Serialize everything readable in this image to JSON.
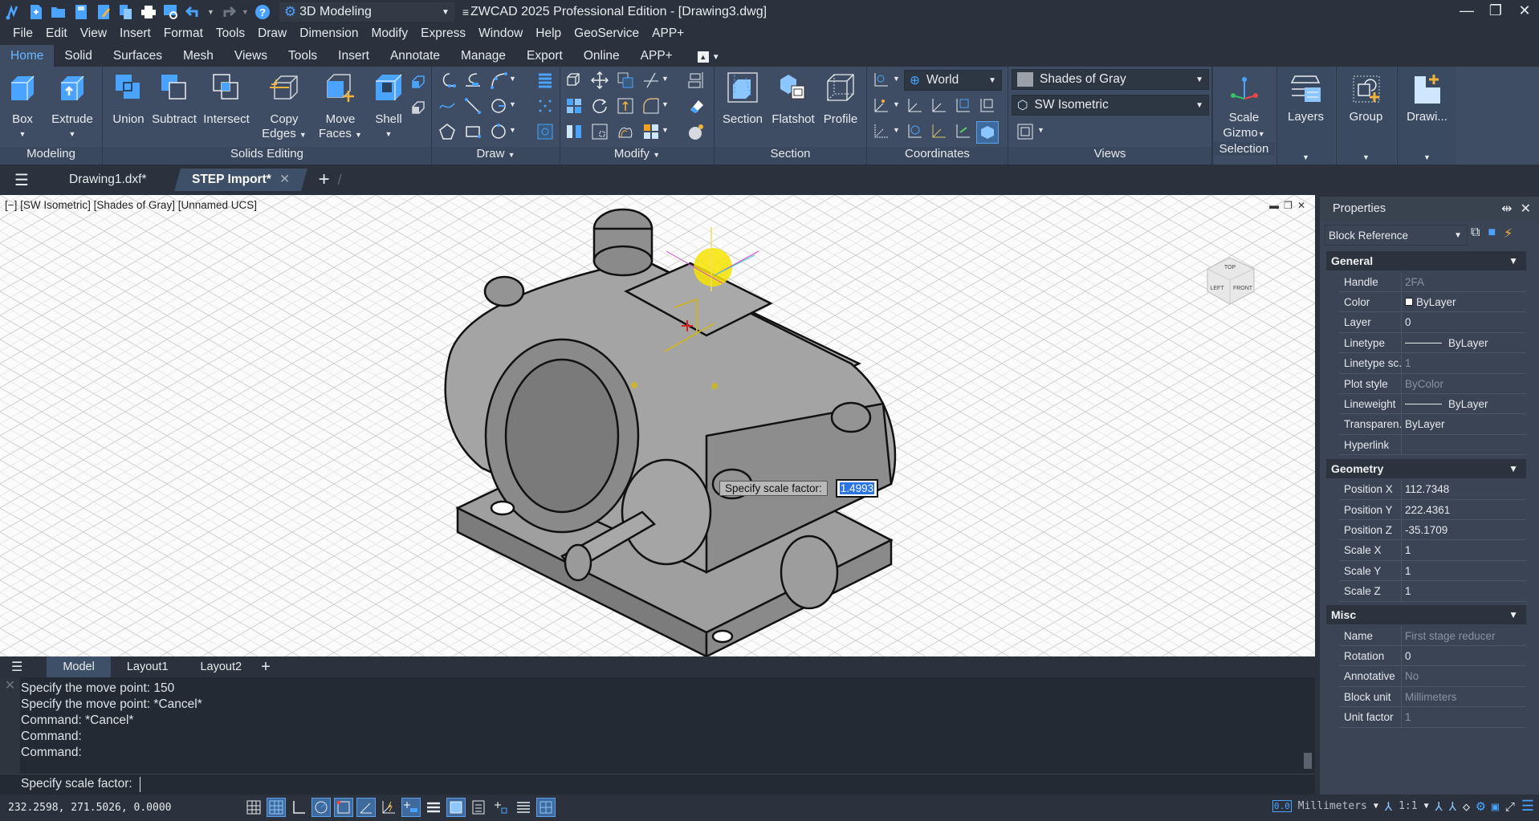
{
  "titlebar": {
    "title": "ZWCAD 2025 Professional Edition - [Drawing3.dwg]",
    "workspace": "3D Modeling",
    "quick_access": [
      "app-logo-icon",
      "new-icon",
      "open-icon",
      "save-icon",
      "save-as-icon",
      "copy-icon",
      "print-icon",
      "preview-icon",
      "undo-icon",
      "redo-icon",
      "help-icon"
    ],
    "window_controls": [
      "minimize",
      "restore",
      "close"
    ]
  },
  "menubar": [
    "File",
    "Edit",
    "View",
    "Insert",
    "Format",
    "Tools",
    "Draw",
    "Dimension",
    "Modify",
    "Express",
    "Window",
    "Help",
    "GeoService",
    "APP+"
  ],
  "ribbon_tabs": [
    {
      "label": "Home",
      "active": true
    },
    {
      "label": "Solid"
    },
    {
      "label": "Surfaces"
    },
    {
      "label": "Mesh"
    },
    {
      "label": "Views"
    },
    {
      "label": "Tools"
    },
    {
      "label": "Insert"
    },
    {
      "label": "Annotate"
    },
    {
      "label": "Manage"
    },
    {
      "label": "Export"
    },
    {
      "label": "Online"
    },
    {
      "label": "APP+"
    }
  ],
  "ribbon": {
    "modeling": {
      "label": "Modeling",
      "box": "Box",
      "extrude": "Extrude"
    },
    "solids_editing": {
      "label": "Solids Editing",
      "union": "Union",
      "subtract": "Subtract",
      "intersect": "Intersect",
      "copy_edges_1": "Copy",
      "copy_edges_2": "Edges",
      "move_faces_1": "Move",
      "move_faces_2": "Faces",
      "shell": "Shell"
    },
    "draw": {
      "label": "Draw"
    },
    "modify": {
      "label": "Modify"
    },
    "section": {
      "label": "Section",
      "section": "Section",
      "flatshot": "Flatshot",
      "profile": "Profile"
    },
    "coordinates": {
      "label": "Coordinates",
      "ucs": "World"
    },
    "views": {
      "label": "Views",
      "visual_style": "Shades of Gray",
      "view": "SW Isometric"
    },
    "selection": {
      "label": "Selection",
      "gizmo_1": "Scale",
      "gizmo_2": "Gizmo"
    },
    "layers": "Layers",
    "group": "Group",
    "drawing": "Drawi..."
  },
  "doc_tabs": [
    {
      "label": "Drawing1.dxf*"
    },
    {
      "label": "STEP Import*",
      "active": true
    }
  ],
  "viewport": {
    "label": "[−] [SW Isometric] [Shades of Gray] [Unnamed UCS]",
    "viewcube": {
      "top": "TOP",
      "left": "LEFT",
      "front": "FRONT"
    },
    "tooltip_label": "Specify scale factor:",
    "tooltip_value": "1.4993"
  },
  "layout_tabs": [
    {
      "label": "Model",
      "active": true
    },
    {
      "label": "Layout1"
    },
    {
      "label": "Layout2"
    }
  ],
  "command": {
    "history": [
      "Specify the move point: 150",
      "Specify the move point: *Cancel*",
      "Command: *Cancel*",
      "Command:",
      "Command:"
    ],
    "prompt": "Specify scale factor:"
  },
  "status": {
    "coords": "232.2598, 271.5026, 0.0000",
    "units": "Millimeters",
    "scale": "1:1"
  },
  "properties": {
    "title": "Properties",
    "selection": "Block Reference",
    "sections": [
      {
        "name": "General",
        "rows": [
          {
            "k": "Handle",
            "v": "2FA",
            "dim": true
          },
          {
            "k": "Color",
            "v": "ByLayer",
            "swatch": true
          },
          {
            "k": "Layer",
            "v": "0"
          },
          {
            "k": "Linetype",
            "v": "ByLayer",
            "line": true
          },
          {
            "k": "Linetype sc...",
            "v": "1",
            "dim": true
          },
          {
            "k": "Plot style",
            "v": "ByColor",
            "dim": true
          },
          {
            "k": "Lineweight",
            "v": "ByLayer",
            "line": true
          },
          {
            "k": "Transparen...",
            "v": "ByLayer"
          },
          {
            "k": "Hyperlink",
            "v": ""
          }
        ]
      },
      {
        "name": "Geometry",
        "rows": [
          {
            "k": "Position X",
            "v": "112.7348"
          },
          {
            "k": "Position Y",
            "v": "222.4361"
          },
          {
            "k": "Position Z",
            "v": "-35.1709"
          },
          {
            "k": "Scale X",
            "v": "1"
          },
          {
            "k": "Scale Y",
            "v": "1"
          },
          {
            "k": "Scale Z",
            "v": "1"
          }
        ]
      },
      {
        "name": "Misc",
        "rows": [
          {
            "k": "Name",
            "v": "First stage reducer",
            "dim": true
          },
          {
            "k": "Rotation",
            "v": "0"
          },
          {
            "k": "Annotative",
            "v": "No",
            "dim": true
          },
          {
            "k": "Block unit",
            "v": "Millimeters",
            "dim": true
          },
          {
            "k": "Unit factor",
            "v": "1",
            "dim": true
          }
        ]
      }
    ]
  }
}
